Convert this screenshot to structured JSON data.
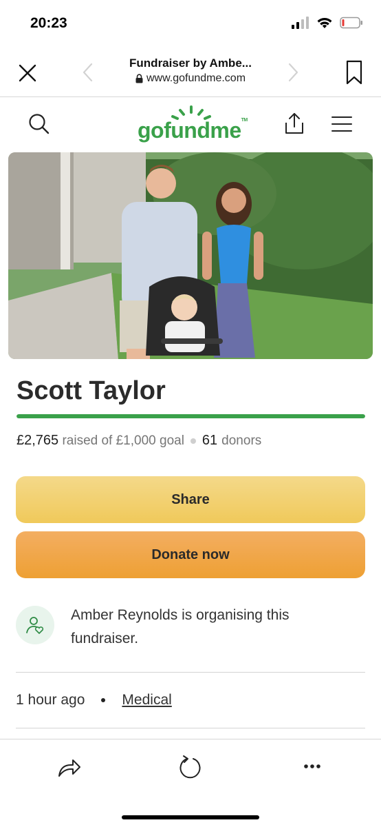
{
  "status_bar": {
    "time": "20:23"
  },
  "browser": {
    "page_title": "Fundraiser by Ambe...",
    "url": "www.gofundme.com"
  },
  "site": {
    "logo_text": "gofundme",
    "brand_color": "#3aa14a"
  },
  "campaign": {
    "title": "Scott Taylor",
    "raised": "£2,765",
    "raised_label": "raised of £1,000 goal",
    "donors_count": "61",
    "donors_label": "donors",
    "progress_fraction": 1.0,
    "share_label": "Share",
    "donate_label": "Donate now",
    "organiser_text": "Amber Reynolds is organising this fundraiser.",
    "posted": "1 hour ago",
    "category": "Medical"
  },
  "colors": {
    "share_button": "#f0c95a",
    "donate_button": "#eea033",
    "progress": "#3aa14a"
  },
  "icons": {
    "close": "close-icon",
    "back": "chevron-left-icon",
    "forward": "chevron-right-icon",
    "bookmark": "bookmark-icon",
    "search": "search-icon",
    "share": "share-icon",
    "menu": "hamburger-menu-icon",
    "organiser": "user-heart-icon",
    "reload": "reload-icon",
    "more": "more-icon"
  }
}
